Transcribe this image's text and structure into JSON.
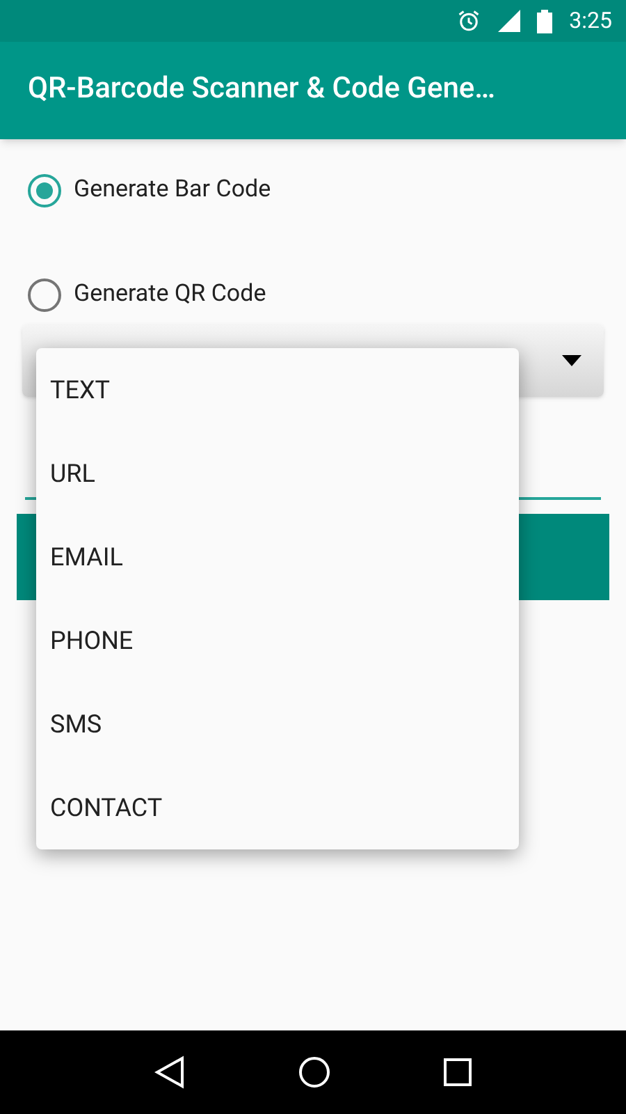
{
  "status_bar": {
    "time": "3:25"
  },
  "app_bar": {
    "title": "QR-Barcode Scanner & Code Gene…"
  },
  "options": [
    {
      "label": "Generate Bar Code",
      "selected": true
    },
    {
      "label": "Generate QR Code",
      "selected": false
    }
  ],
  "dropdown_menu": {
    "items": [
      "TEXT",
      "URL",
      "EMAIL",
      "PHONE",
      "SMS",
      "CONTACT"
    ]
  }
}
